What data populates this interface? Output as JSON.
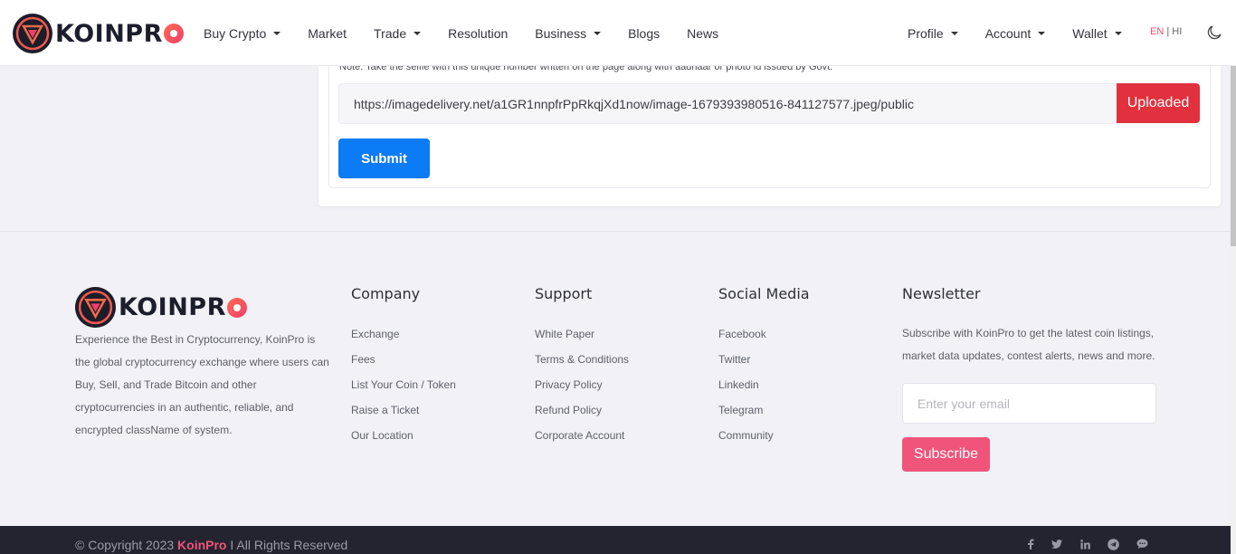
{
  "brand": {
    "name": "KOINPR"
  },
  "nav": {
    "left": [
      {
        "label": "Buy Crypto",
        "dropdown": true
      },
      {
        "label": "Market",
        "dropdown": false
      },
      {
        "label": "Trade",
        "dropdown": true
      },
      {
        "label": "Resolution",
        "dropdown": false
      },
      {
        "label": "Business",
        "dropdown": true
      },
      {
        "label": "Blogs",
        "dropdown": false
      },
      {
        "label": "News",
        "dropdown": false
      }
    ],
    "right": [
      {
        "label": "Profile",
        "dropdown": true
      },
      {
        "label": "Account",
        "dropdown": true
      },
      {
        "label": "Wallet",
        "dropdown": true
      }
    ],
    "lang_en": "EN",
    "lang_sep": " | ",
    "lang_hi": "HI",
    "theme_icon": "moon-icon"
  },
  "form": {
    "note": "Note: Take the selfie with this unique number written on the page along with aadhaar or photo id issued by Govt.",
    "url_value": "https://imagedelivery.net/a1GR1nnpfrPpRkqjXd1now/image-1679393980516-841127577.jpeg/public",
    "uploaded_label": "Uploaded",
    "submit_label": "Submit"
  },
  "footer": {
    "description": "Experience the Best in Cryptocurrency, KoinPro is the global cryptocurrency exchange where users can Buy, Sell, and Trade Bitcoin and other cryptocurrencies in an authentic, reliable, and encrypted className of system.",
    "company": {
      "title": "Company",
      "links": [
        "Exchange",
        "Fees",
        "List Your Coin / Token",
        "Raise a Ticket",
        "Our Location"
      ]
    },
    "support": {
      "title": "Support",
      "links": [
        "White Paper",
        "Terms & Conditions",
        "Privacy Policy",
        "Refund Policy",
        "Corporate Account"
      ]
    },
    "social": {
      "title": "Social Media",
      "links": [
        "Facebook",
        "Twitter",
        "Linkedin",
        "Telegram",
        "Community"
      ]
    },
    "newsletter": {
      "title": "Newsletter",
      "text": "Subscribe with KoinPro to get the latest coin listings, market data updates, contest alerts, news and more.",
      "placeholder": "Enter your email",
      "button": "Subscribe"
    },
    "copyright_prefix": "© Copyright 2023 ",
    "copyright_brand": "KoinPro",
    "copyright_suffix": " I All Rights Reserved",
    "social_icons": [
      "facebook-icon",
      "twitter-icon",
      "linkedin-icon",
      "telegram-icon",
      "chat-icon"
    ]
  },
  "colors": {
    "accent": "#f0547a",
    "primary_button": "#0c7bf6",
    "danger_button": "#e1313e",
    "footer_bar": "#23242f"
  }
}
